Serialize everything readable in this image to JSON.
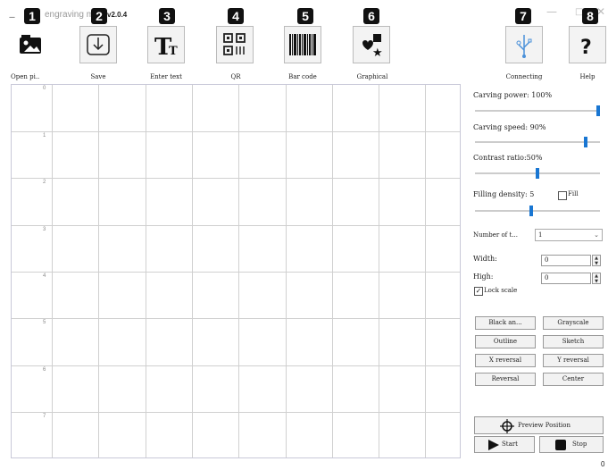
{
  "window": {
    "app_icon": "---",
    "title": "engraving ma",
    "version": "v2.0.4",
    "minimize": "—",
    "maximize": "□",
    "close": "✕"
  },
  "badges": [
    "1",
    "2",
    "3",
    "4",
    "5",
    "6",
    "7",
    "8"
  ],
  "toolbar": {
    "open": "Open pi..",
    "save": "Save",
    "enter_text": "Enter text",
    "qr": "QR",
    "bar_code": "Bar code",
    "graphical": "Graphical",
    "connecting": "Connecting",
    "help": "Help"
  },
  "ruler": [
    "0",
    "1",
    "2",
    "3",
    "4",
    "5",
    "6",
    "7"
  ],
  "panel": {
    "carving_power": "Carving power: 100%",
    "carving_power_value": 100,
    "carving_speed": "Carving speed: 90%",
    "carving_speed_value": 90,
    "contrast_ratio": "Contrast ratio:50%",
    "contrast_ratio_value": 50,
    "filling_density": "Filling density: 5",
    "filling_density_value": 5,
    "fill_label": "Fill",
    "number_of_times_label": "Number of t...",
    "number_of_times_value": "1",
    "width_label": "Width:",
    "width_value": "0",
    "high_label": "High:",
    "high_value": "0",
    "lock_scale": "Lock scale",
    "lock_checked": "✓"
  },
  "buttons": {
    "black_and_white": "Black an...",
    "grayscale": "Grayscale",
    "outline": "Outline",
    "sketch": "Sketch",
    "x_reversal": "X reversal",
    "y_reversal": "Y reversal",
    "reversal": "Reversal",
    "center": "Center",
    "preview_position": "Preview Position",
    "start": "Start",
    "stop": "Stop"
  },
  "status": {
    "corner_value": "0"
  },
  "colors": {
    "accent": "#1976d2",
    "badge": "#111111",
    "grid": "#d0d0d0"
  }
}
